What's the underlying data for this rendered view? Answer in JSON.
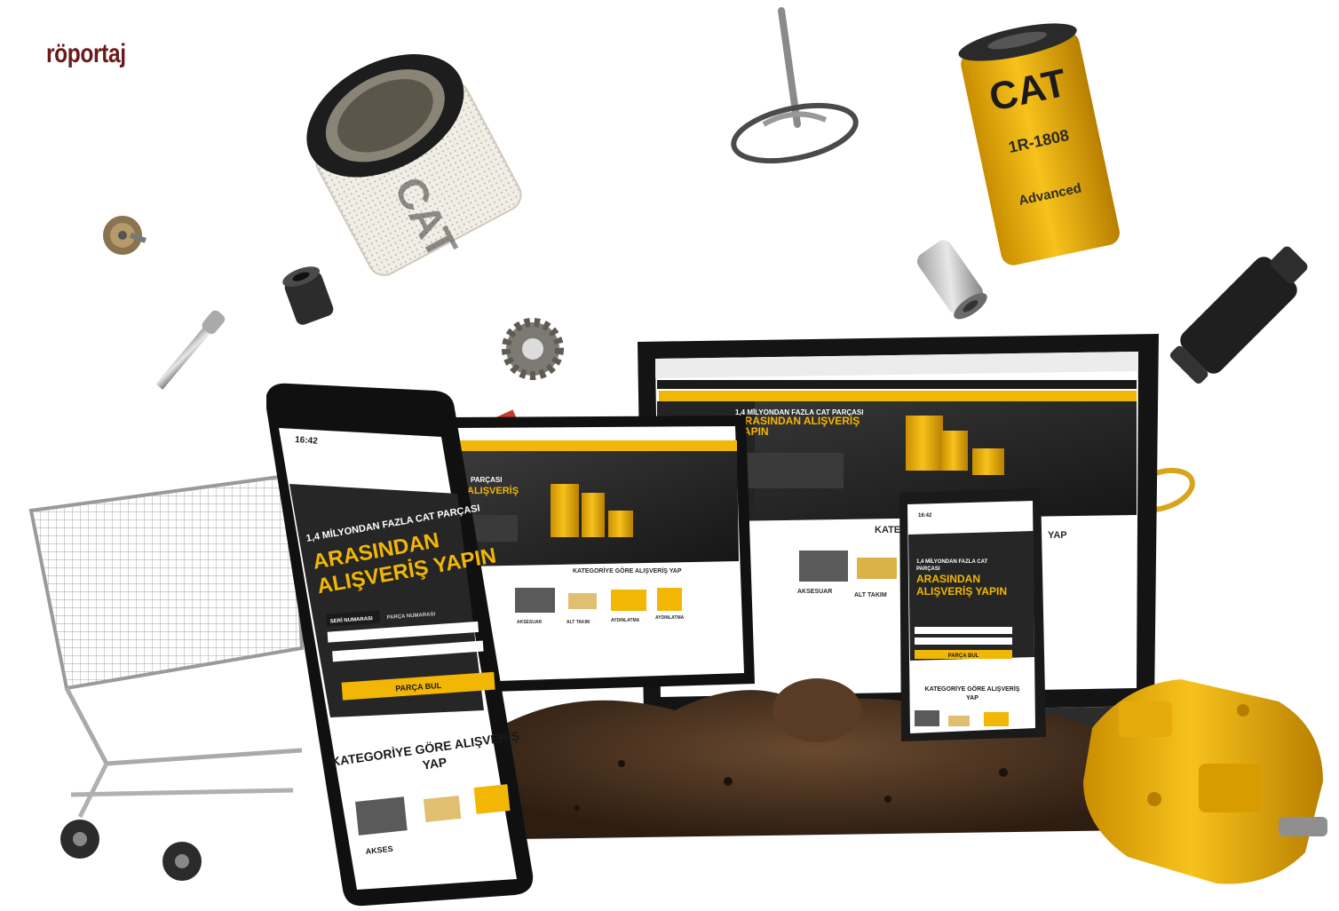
{
  "section_tag": "röportaj",
  "filter_brand": "CAT",
  "filter_part_number": "1R-1808",
  "filter_grade": "Advanced",
  "phone": {
    "status_time": "16:42",
    "headline_small": "1,4 MİLYONDAN FAZLA CAT PARÇASI",
    "headline_big_1": "ARASINDAN",
    "headline_big_2": "ALIŞVERİŞ YAPIN",
    "tab_1": "SERİ NUMARASI",
    "tab_2": "PARÇA NUMARASI",
    "button": "PARÇA BUL",
    "category_heading_1": "KATEGORİYE GÖRE ALIŞVERİŞ",
    "category_heading_2": "YAP",
    "category_item": "AKSES"
  },
  "tablet": {
    "headline_small": "PARÇASI",
    "headline_big": "ALIŞVERİŞ",
    "category_heading": "KATEGORİYE GÖRE ALIŞVERİŞ YAP",
    "cat_1": "AKSESUAR",
    "cat_2": "ALT TAKIM",
    "cat_3": "AYDINLATMA",
    "cat_4": "AYDINLATMA"
  },
  "laptop": {
    "headline_small": "1,4 MİLYONDAN FAZLA CAT PARÇASI",
    "headline_big_1": "ARASINDAN ALIŞVERİŞ",
    "headline_big_2": "YAPIN",
    "category_heading_left": "KATEG",
    "category_heading_right": "YAP",
    "cat_1": "AKSESUAR",
    "cat_2": "ALT TAKIM"
  },
  "small_phone": {
    "status_time": "16:42",
    "headline_small_1": "1,4 MİLYONDAN FAZLA CAT",
    "headline_small_2": "PARÇASI",
    "headline_big_1": "ARASINDAN",
    "headline_big_2": "ALIŞVERİŞ YAPIN",
    "button": "PARÇA BUL",
    "category_heading_1": "KATEGORİYE GÖRE ALIŞVERİŞ",
    "category_heading_2": "YAP"
  },
  "colors": {
    "section_tag": "#6b1a1a",
    "cat_yellow": "#f2b705",
    "screen_dark": "#2a2a2a",
    "soil": "#4a3222"
  }
}
